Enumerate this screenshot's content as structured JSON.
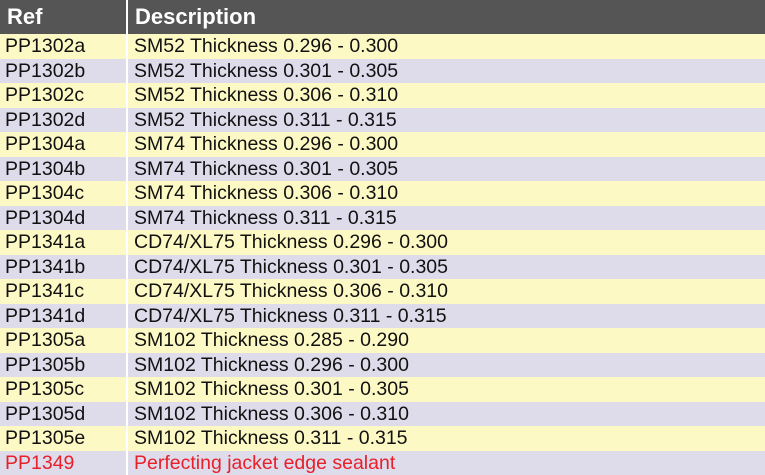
{
  "table": {
    "headers": {
      "ref": "Ref",
      "description": "Description"
    },
    "colors": {
      "header_bg": "#555555",
      "row_odd": "#fdf9c4",
      "row_even": "#dedbeb",
      "highlight_text": "#e8202a"
    },
    "rows": [
      {
        "ref": "PP1302a",
        "description": "SM52 Thickness 0.296 - 0.300"
      },
      {
        "ref": "PP1302b",
        "description": "SM52 Thickness 0.301 - 0.305"
      },
      {
        "ref": "PP1302c",
        "description": "SM52 Thickness 0.306 - 0.310"
      },
      {
        "ref": "PP1302d",
        "description": "SM52 Thickness 0.311 - 0.315"
      },
      {
        "ref": "PP1304a",
        "description": "SM74 Thickness 0.296 - 0.300"
      },
      {
        "ref": "PP1304b",
        "description": "SM74 Thickness 0.301 - 0.305"
      },
      {
        "ref": "PP1304c",
        "description": "SM74 Thickness 0.306 - 0.310"
      },
      {
        "ref": "PP1304d",
        "description": "SM74 Thickness 0.311 - 0.315"
      },
      {
        "ref": "PP1341a",
        "description": "CD74/XL75 Thickness 0.296 - 0.300"
      },
      {
        "ref": "PP1341b",
        "description": "CD74/XL75 Thickness 0.301 - 0.305"
      },
      {
        "ref": "PP1341c",
        "description": "CD74/XL75 Thickness 0.306 - 0.310"
      },
      {
        "ref": "PP1341d",
        "description": "CD74/XL75 Thickness 0.311 - 0.315"
      },
      {
        "ref": "PP1305a",
        "description": "SM102 Thickness 0.285 - 0.290"
      },
      {
        "ref": "PP1305b",
        "description": "SM102 Thickness 0.296 - 0.300"
      },
      {
        "ref": "PP1305c",
        "description": "SM102 Thickness 0.301 - 0.305"
      },
      {
        "ref": "PP1305d",
        "description": "SM102 Thickness 0.306 - 0.310"
      },
      {
        "ref": "PP1305e",
        "description": "SM102 Thickness 0.311 - 0.315"
      },
      {
        "ref": "PP1349",
        "description": "Perfecting jacket edge sealant",
        "highlight": true
      }
    ]
  }
}
